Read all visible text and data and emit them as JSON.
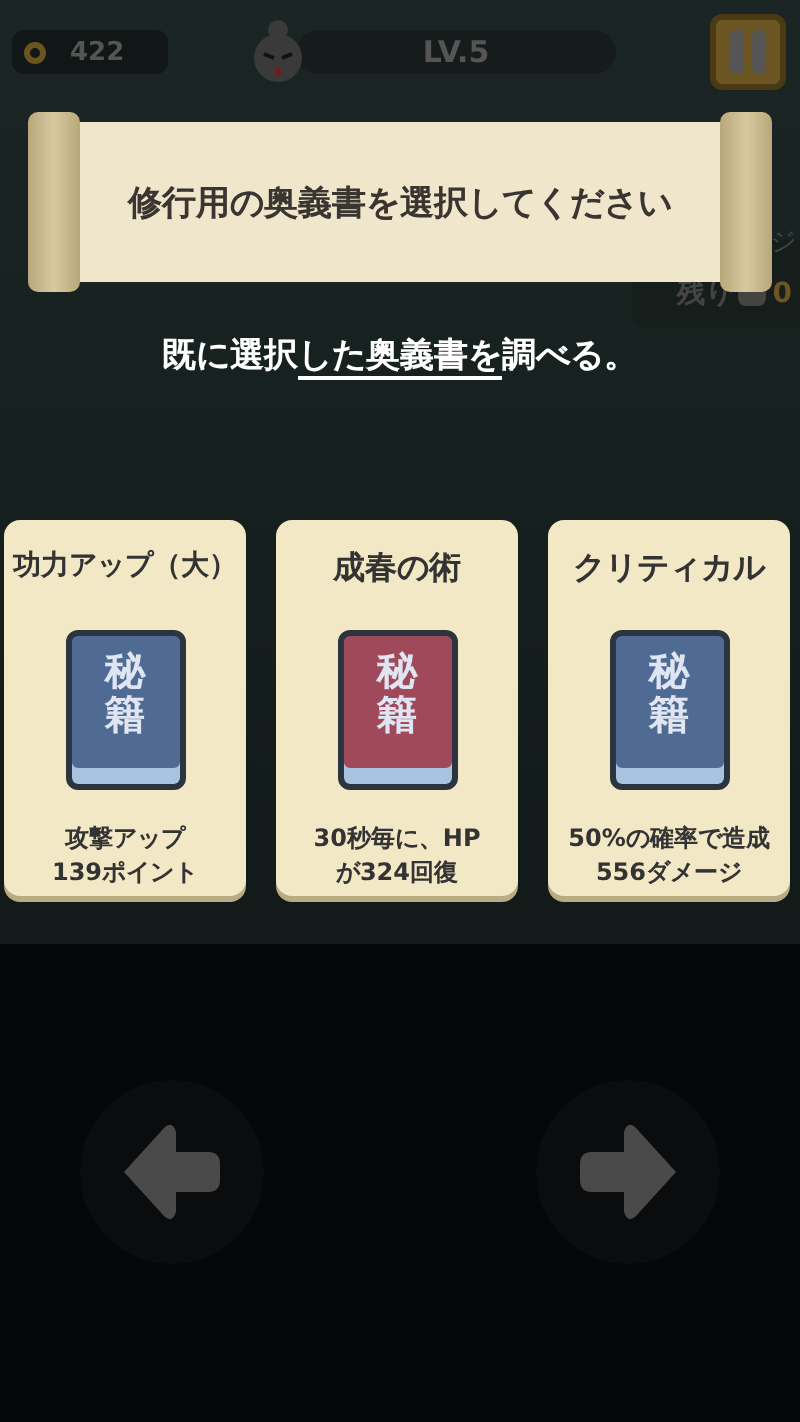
{
  "hud": {
    "coins": "422",
    "level": "LV.5"
  },
  "banner": {
    "title": "修行用の奥義書を選択してください"
  },
  "side_panel": {
    "label_top": "ジ",
    "remaining": "残り",
    "count": "0"
  },
  "hint": {
    "before": "既に選択",
    "link": "した奥義書を",
    "after": "調べる。"
  },
  "cards": [
    {
      "title": "功力アップ（大）",
      "book_label": "秘籍",
      "color": "#4f6b94",
      "description": "攻撃アップ\n139ポイント"
    },
    {
      "title": "成春の術",
      "book_label": "秘籍",
      "color": "#a0495a",
      "description": "30秒毎に、HP\nが324回復"
    },
    {
      "title": "クリティカル",
      "book_label": "秘籍",
      "color": "#4f6b94",
      "description": "50%の確率で造成\n556ダメージ"
    }
  ]
}
